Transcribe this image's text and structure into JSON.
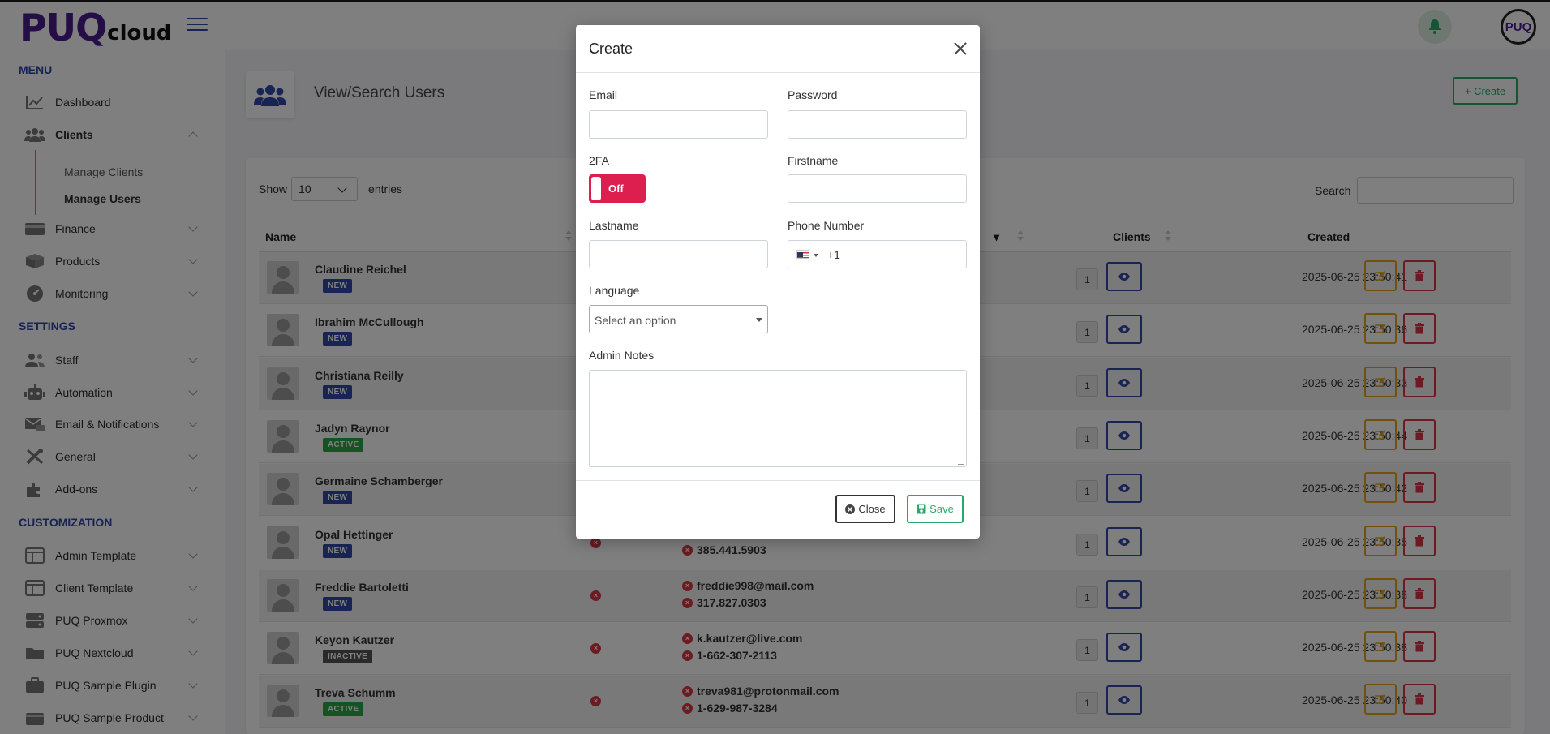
{
  "app": {
    "logo_main": "PUQ",
    "logo_sub": "cloud",
    "avatar_initials": "PUQ"
  },
  "sidebar": {
    "menu_title": "MENU",
    "settings_title": "SETTINGS",
    "customization_title": "CUSTOMIZATION",
    "menu_items": [
      {
        "label": "Dashboard",
        "icon": "chart-line-icon"
      },
      {
        "label": "Clients",
        "icon": "users-icon"
      },
      {
        "label": "Finance",
        "icon": "wallet-icon"
      },
      {
        "label": "Products",
        "icon": "box-icon"
      },
      {
        "label": "Monitoring",
        "icon": "gauge-icon"
      }
    ],
    "clients_sub": [
      {
        "label": "Manage Clients"
      },
      {
        "label": "Manage Users"
      }
    ],
    "settings_items": [
      {
        "label": "Staff",
        "icon": "staff-icon"
      },
      {
        "label": "Automation",
        "icon": "robot-icon"
      },
      {
        "label": "Email & Notifications",
        "icon": "mail-icon"
      },
      {
        "label": "General",
        "icon": "tools-icon"
      },
      {
        "label": "Add-ons",
        "icon": "puzzle-icon"
      }
    ],
    "customization_items": [
      {
        "label": "Admin Template",
        "icon": "layout-icon"
      },
      {
        "label": "Client Template",
        "icon": "layout-icon"
      },
      {
        "label": "PUQ Proxmox",
        "icon": "server-icon"
      },
      {
        "label": "PUQ Nextcloud",
        "icon": "folder-icon"
      },
      {
        "label": "PUQ Sample Plugin",
        "icon": "briefcase-icon"
      },
      {
        "label": "PUQ Sample Product",
        "icon": "box-icon"
      }
    ]
  },
  "page": {
    "title": "View/Search Users",
    "create_label": "+ Create",
    "show_label": "Show",
    "entries_value": "10",
    "entries_label": "entries",
    "search_label": "Search"
  },
  "table": {
    "headers": {
      "name": "Name",
      "clients": "Clients",
      "created": "Created"
    },
    "rows": [
      {
        "name": "Claudine Reichel",
        "status": "NEW",
        "email": "",
        "phone": "",
        "clients": "1",
        "created": "2025-06-25 23:50:41"
      },
      {
        "name": "Ibrahim McCullough",
        "status": "NEW",
        "email": "",
        "phone": "",
        "clients": "1",
        "created": "2025-06-25 23:50:36"
      },
      {
        "name": "Christiana Reilly",
        "status": "NEW",
        "email": "",
        "phone": "",
        "clients": "1",
        "created": "2025-06-25 23:50:33"
      },
      {
        "name": "Jadyn Raynor",
        "status": "ACTIVE",
        "email": "",
        "phone": "",
        "clients": "1",
        "created": "2025-06-25 23:50:44"
      },
      {
        "name": "Germaine Schamberger",
        "status": "NEW",
        "email": "",
        "phone": "",
        "clients": "1",
        "created": "2025-06-25 23:50:42"
      },
      {
        "name": "Opal Hettinger",
        "status": "NEW",
        "email": "",
        "phone": "385.441.5903",
        "clients": "1",
        "created": "2025-06-25 23:50:35"
      },
      {
        "name": "Freddie Bartoletti",
        "status": "NEW",
        "email": "freddie998@mail.com",
        "phone": "317.827.0303",
        "clients": "1",
        "created": "2025-06-25 23:50:38"
      },
      {
        "name": "Keyon Kautzer",
        "status": "INACTIVE",
        "email": "k.kautzer@live.com",
        "phone": "1-662-307-2113",
        "clients": "1",
        "created": "2025-06-25 23:50:38"
      },
      {
        "name": "Treva Schumm",
        "status": "ACTIVE",
        "email": "treva981@protonmail.com",
        "phone": "1-629-987-3284",
        "clients": "1",
        "created": "2025-06-25 23:50:40"
      }
    ]
  },
  "modal": {
    "title": "Create",
    "email_label": "Email",
    "password_label": "Password",
    "twofa_label": "2FA",
    "twofa_state": "Off",
    "firstname_label": "Firstname",
    "lastname_label": "Lastname",
    "phone_label": "Phone Number",
    "phone_code": "+1",
    "language_label": "Language",
    "language_placeholder": "Select an option",
    "notes_label": "Admin Notes",
    "close_label": "Close",
    "save_label": "Save"
  },
  "colors": {
    "brand": "#4b1d8c",
    "primary": "#3248a8",
    "success": "#2aa86a",
    "danger": "#dc3545",
    "toggle_off": "#dc1f4e",
    "warning": "#e8a317"
  }
}
